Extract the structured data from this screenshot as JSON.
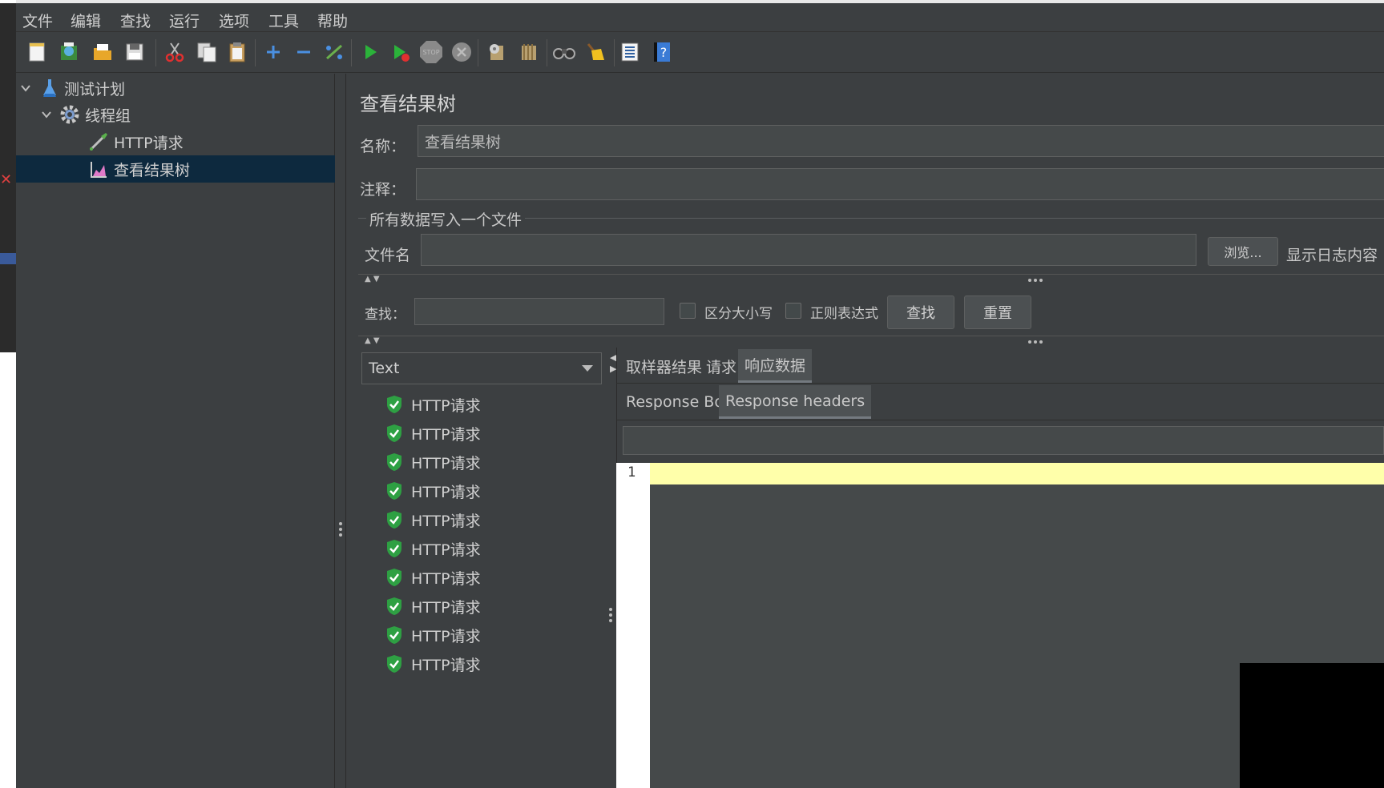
{
  "menu": [
    "文件",
    "编辑",
    "查找",
    "运行",
    "选项",
    "工具",
    "帮助"
  ],
  "toolbar_icons": [
    "new-icon",
    "templates-icon",
    "open-icon",
    "save-icon",
    "cut-icon",
    "copy-icon",
    "paste-icon",
    "expand-icon",
    "collapse-icon",
    "toggle-icon",
    "start-icon",
    "start-no-pause-icon",
    "stop-icon",
    "shutdown-icon",
    "clear-icon",
    "clear-all-icon",
    "search-icon",
    "reset-search-icon",
    "function-helper-icon",
    "help-icon"
  ],
  "tree": {
    "items": [
      {
        "label": "测试计划",
        "icon": "flask-icon"
      },
      {
        "label": "线程组",
        "icon": "gear-icon"
      },
      {
        "label": "HTTP请求",
        "icon": "pipette-icon"
      },
      {
        "label": "查看结果树",
        "icon": "chart-icon"
      }
    ]
  },
  "panel": {
    "title": "查看结果树",
    "name_label": "名称：",
    "name_value": "查看结果树",
    "comment_label": "注释：",
    "comment_value": "",
    "file_group_label": "所有数据写入一个文件",
    "file_label": "文件名",
    "file_value": "",
    "browse_button": "浏览...",
    "log_label": "显示日志内容"
  },
  "search": {
    "label": "查找：",
    "value": "",
    "case_sensitive": "区分大小写",
    "regex": "正则表达式",
    "find_button": "查找",
    "reset_button": "重置"
  },
  "results": {
    "renderer": "Text",
    "items": [
      "HTTP请求",
      "HTTP请求",
      "HTTP请求",
      "HTTP请求",
      "HTTP请求",
      "HTTP请求",
      "HTTP请求",
      "HTTP请求",
      "HTTP请求",
      "HTTP请求"
    ]
  },
  "tabs": {
    "main": [
      "取样器结果",
      "请求",
      "响应数据"
    ],
    "sub": [
      "Response Body",
      "Response headers"
    ]
  },
  "editor": {
    "line_number": "1"
  },
  "colors": {
    "background": "#3c3f41",
    "selection": "#0d293e",
    "highlight_line": "#ffffaa",
    "success_green": "#2ea043"
  }
}
